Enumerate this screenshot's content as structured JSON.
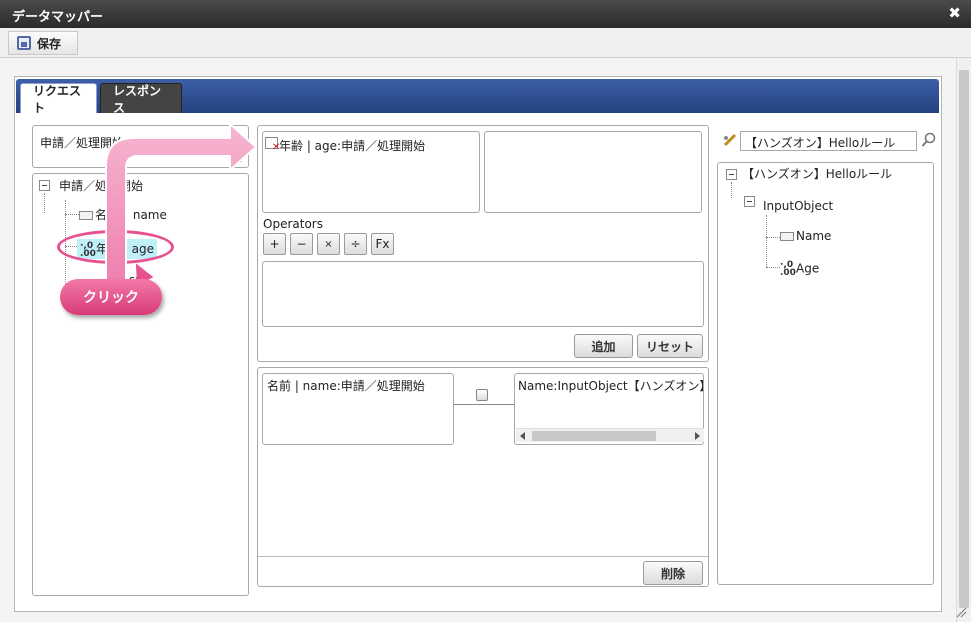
{
  "window": {
    "title": "データマッパー",
    "close_glyph": "✖"
  },
  "toolbar": {
    "save_label": "保存"
  },
  "tabs": [
    {
      "label": "リクエスト",
      "active": true
    },
    {
      "label": "レスポンス",
      "active": false
    }
  ],
  "left": {
    "selector_value": "申請／処理開始",
    "tree_root": "申請／処理開始",
    "tree_items": [
      "名前 | name",
      "年齢 | age",
      "結果 | result"
    ],
    "name_partial": "名",
    "name_rest": "name",
    "result_partial": "sult"
  },
  "middle": {
    "expression_item": "年齢 | age:申請／処理開始",
    "operators_label": "Operators",
    "operators": [
      "+",
      "−",
      "×",
      "÷",
      "Fx"
    ],
    "add_button": "追加",
    "reset_button": "リセット",
    "mapping_source": "名前 | name:申請／処理開始",
    "mapping_target": "Name:InputObject【ハンズオン】Hel",
    "delete_button": "削除"
  },
  "right": {
    "search_value": "【ハンズオン】Helloルール",
    "tree_root": "【ハンズオン】Helloルール",
    "tree_object": "InputObject",
    "tree_fields": [
      "Name",
      "Age"
    ]
  },
  "annotation": {
    "click_label": "クリック"
  },
  "colors": {
    "title_bar": "#2b2b2b",
    "tab_band": "#24427f",
    "callout": "#e8518f",
    "highlight": "#bff0f8"
  }
}
